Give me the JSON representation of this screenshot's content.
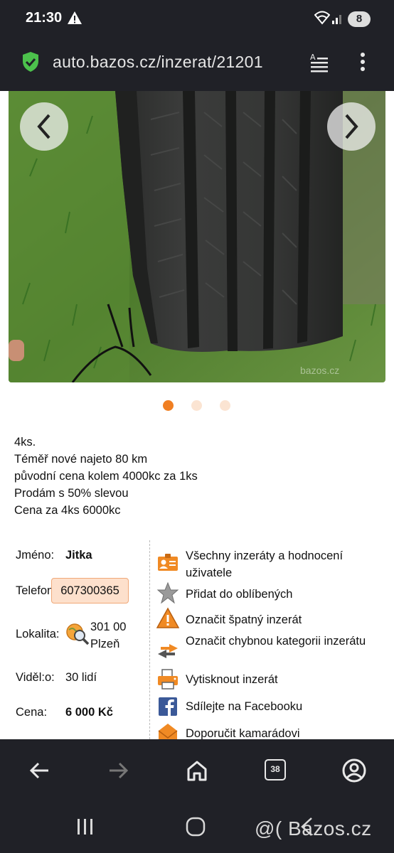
{
  "status_bar": {
    "time": "21:30",
    "battery": "8"
  },
  "browser": {
    "url": "auto.bazos.cz/inzerat/21201"
  },
  "gallery": {
    "slides": 3,
    "active_slide": 1,
    "photo_watermark": "bazos.cz"
  },
  "description": {
    "lines": [
      "4ks.",
      "Téměř nové najeto 80 km",
      "původní cena kolem 4000kc za 1ks",
      "Prodám s 50% slevou",
      "Cena za 4ks 6000kc"
    ]
  },
  "seller": {
    "name_label": "Jméno:",
    "name": "Jitka",
    "phone_label": "Telefon:",
    "phone": "607300365",
    "location_label": "Lokalita:",
    "zip": "301 00",
    "city": "Plzeň",
    "views_label": "Viděl:",
    "views_label_suffix": "o:",
    "views": "30 lidí",
    "price_label": "Cena:",
    "price": "6 000 Kč"
  },
  "actions": [
    {
      "label": "Všechny inzeráty a hodnocení uživatele",
      "icon": "user-card-icon"
    },
    {
      "label": "Přidat do oblíbených",
      "icon": "star-icon"
    },
    {
      "label": "Označit špatný inzerát",
      "icon": "warning-icon"
    },
    {
      "label": "Označit chybnou kategorii inzerátu",
      "icon": "swap-arrows-icon"
    },
    {
      "label": "Vytisknout inzerát",
      "icon": "printer-icon"
    },
    {
      "label": "Sdílejte na Facebooku",
      "icon": "facebook-icon"
    },
    {
      "label": "Doporučit kamarádovi",
      "icon": "envelope-icon"
    }
  ],
  "bottom_nav": {
    "tab_count": "38"
  },
  "watermark": "@( Bazos.cz",
  "colors": {
    "accent": "#f07f22",
    "dark_bar": "#202127",
    "phone_bg": "#fde0cc"
  }
}
